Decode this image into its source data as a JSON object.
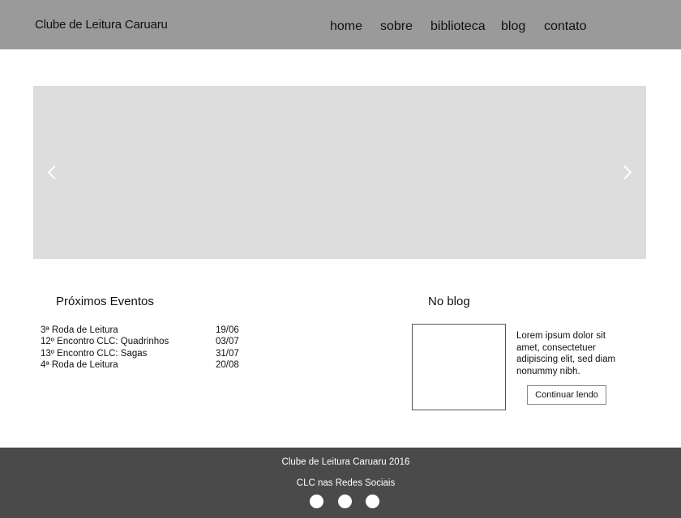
{
  "header": {
    "site_title": "Clube de Leitura Caruaru",
    "nav": [
      {
        "label": "home"
      },
      {
        "label": "sobre"
      },
      {
        "label": "biblioteca"
      },
      {
        "label": "blog"
      },
      {
        "label": "contato"
      }
    ]
  },
  "carousel": {
    "prev_icon": "chevron-left-icon",
    "next_icon": "chevron-right-icon"
  },
  "events": {
    "title": "Próximos Eventos",
    "items": [
      {
        "name": "3ª Roda de Leitura",
        "date": "19/06"
      },
      {
        "name": "12º Encontro CLC: Quadrinhos",
        "date": "03/07"
      },
      {
        "name": "13º Encontro CLC: Sagas",
        "date": "31/07"
      },
      {
        "name": "4ª Roda de Leitura",
        "date": "20/08"
      }
    ]
  },
  "blog": {
    "title": "No blog",
    "excerpt": "Lorem ipsum dolor sit amet, consectetuer adipiscing elit, sed diam nonummy nibh.",
    "button_label": "Continuar lendo"
  },
  "footer": {
    "copyright": "Clube de Leitura Caruaru 2016",
    "social_label": "CLC nas Redes Sociais",
    "social_icons": [
      "social-icon",
      "social-icon",
      "social-icon"
    ]
  },
  "colors": {
    "header_bg": "#9a9a9a",
    "carousel_bg": "#dddddd",
    "footer_bg": "#4a4a4a"
  }
}
